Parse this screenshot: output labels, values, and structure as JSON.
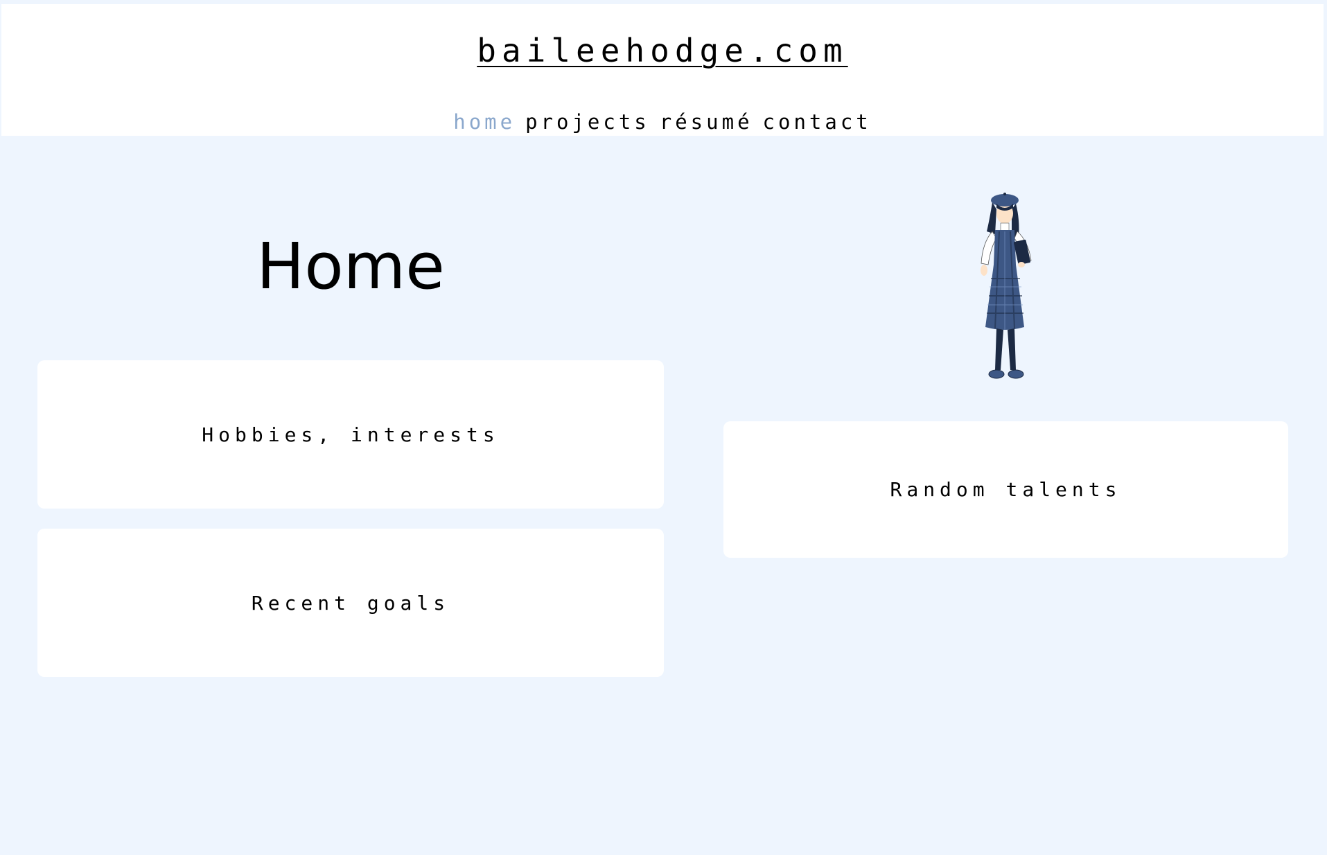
{
  "header": {
    "site_title": "baileehodge.com",
    "nav": [
      {
        "label": "home",
        "active": true
      },
      {
        "label": "projects",
        "active": false
      },
      {
        "label": "résumé",
        "active": false
      },
      {
        "label": "contact",
        "active": false
      }
    ]
  },
  "main": {
    "title": "Home",
    "cards": {
      "hobbies": "Hobbies, interests",
      "goals": "Recent goals",
      "talents": "Random talents"
    }
  },
  "colors": {
    "background": "#eef5fe",
    "nav_active": "#8aa7cc",
    "dress": "#3d5785"
  }
}
